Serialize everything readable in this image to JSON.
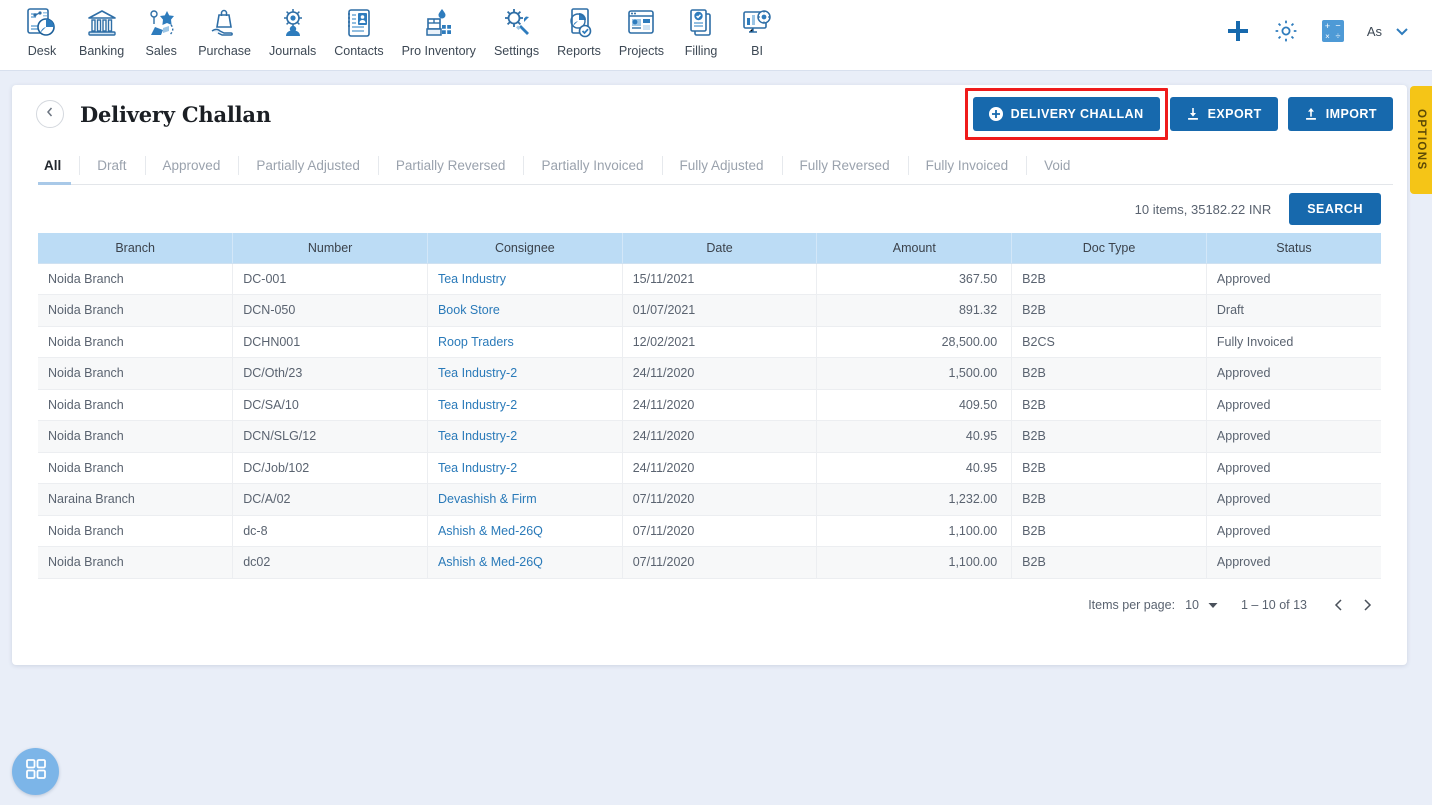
{
  "nav": {
    "items": [
      {
        "label": "Desk",
        "icon": "desk-icon"
      },
      {
        "label": "Banking",
        "icon": "bank-icon"
      },
      {
        "label": "Sales",
        "icon": "sales-icon"
      },
      {
        "label": "Purchase",
        "icon": "purchase-icon"
      },
      {
        "label": "Journals",
        "icon": "journals-icon"
      },
      {
        "label": "Contacts",
        "icon": "contacts-icon"
      },
      {
        "label": "Pro Inventory",
        "icon": "inventory-icon"
      },
      {
        "label": "Settings",
        "icon": "settings-icon"
      },
      {
        "label": "Reports",
        "icon": "reports-icon"
      },
      {
        "label": "Projects",
        "icon": "projects-icon"
      },
      {
        "label": "Filling",
        "icon": "filling-icon"
      },
      {
        "label": "BI",
        "icon": "bi-icon"
      }
    ],
    "right": {
      "add_icon": "plus-icon",
      "settings_icon": "gear-icon",
      "calculator_icon": "calculator-icon",
      "user_name": "As",
      "chevron_icon": "chevron-down-icon"
    }
  },
  "header": {
    "back_icon": "chevron-left-icon",
    "title": "Delivery Challan",
    "buttons": {
      "create": {
        "label": "DELIVERY CHALLAN",
        "icon": "plus-circle-icon",
        "highlighted": true
      },
      "export": {
        "label": "EXPORT",
        "icon": "download-icon"
      },
      "import": {
        "label": "IMPORT",
        "icon": "upload-icon"
      }
    }
  },
  "tabs": [
    {
      "label": "All",
      "active": true
    },
    {
      "label": "Draft",
      "active": false
    },
    {
      "label": "Approved",
      "active": false
    },
    {
      "label": "Partially Adjusted",
      "active": false
    },
    {
      "label": "Partially Reversed",
      "active": false
    },
    {
      "label": "Partially Invoiced",
      "active": false
    },
    {
      "label": "Fully Adjusted",
      "active": false
    },
    {
      "label": "Fully Reversed",
      "active": false
    },
    {
      "label": "Fully Invoiced",
      "active": false
    },
    {
      "label": "Void",
      "active": false
    }
  ],
  "search_row": {
    "items_summary": "10 items, 35182.22 INR",
    "search_label": "SEARCH"
  },
  "table": {
    "columns": [
      "Branch",
      "Number",
      "Consignee",
      "Date",
      "Amount",
      "Doc Type",
      "Status"
    ],
    "rows": [
      {
        "branch": "Noida Branch",
        "number": "DC-001",
        "consignee": "Tea Industry",
        "date": "15/11/2021",
        "amount": "367.50",
        "doc_type": "B2B",
        "status": "Approved"
      },
      {
        "branch": "Noida Branch",
        "number": "DCN-050",
        "consignee": "Book Store",
        "date": "01/07/2021",
        "amount": "891.32",
        "doc_type": "B2B",
        "status": "Draft"
      },
      {
        "branch": "Noida Branch",
        "number": "DCHN001",
        "consignee": "Roop Traders",
        "date": "12/02/2021",
        "amount": "28,500.00",
        "doc_type": "B2CS",
        "status": "Fully Invoiced"
      },
      {
        "branch": "Noida Branch",
        "number": "DC/Oth/23",
        "consignee": "Tea Industry-2",
        "date": "24/11/2020",
        "amount": "1,500.00",
        "doc_type": "B2B",
        "status": "Approved"
      },
      {
        "branch": "Noida Branch",
        "number": "DC/SA/10",
        "consignee": "Tea Industry-2",
        "date": "24/11/2020",
        "amount": "409.50",
        "doc_type": "B2B",
        "status": "Approved"
      },
      {
        "branch": "Noida Branch",
        "number": "DCN/SLG/12",
        "consignee": "Tea Industry-2",
        "date": "24/11/2020",
        "amount": "40.95",
        "doc_type": "B2B",
        "status": "Approved"
      },
      {
        "branch": "Noida Branch",
        "number": "DC/Job/102",
        "consignee": "Tea Industry-2",
        "date": "24/11/2020",
        "amount": "40.95",
        "doc_type": "B2B",
        "status": "Approved"
      },
      {
        "branch": "Naraina Branch",
        "number": "DC/A/02",
        "consignee": "Devashish & Firm",
        "date": "07/11/2020",
        "amount": "1,232.00",
        "doc_type": "B2B",
        "status": "Approved"
      },
      {
        "branch": "Noida Branch",
        "number": "dc-8",
        "consignee": "Ashish & Med-26Q",
        "date": "07/11/2020",
        "amount": "1,100.00",
        "doc_type": "B2B",
        "status": "Approved"
      },
      {
        "branch": "Noida Branch",
        "number": "dc02",
        "consignee": "Ashish & Med-26Q",
        "date": "07/11/2020",
        "amount": "1,100.00",
        "doc_type": "B2B",
        "status": "Approved"
      }
    ]
  },
  "paginator": {
    "items_per_page_label": "Items per page:",
    "items_per_page_value": "10",
    "range": "1 – 10 of 13",
    "prev_icon": "chevron-left-icon",
    "next_icon": "chevron-right-icon"
  },
  "options_tab": {
    "label": "OPTIONS"
  },
  "fab": {
    "icon": "grid-apps-icon"
  },
  "colors": {
    "accent_blue": "#1769ad",
    "link_blue": "#2a7ab9",
    "table_header": "#bcdcf5",
    "highlight_red": "#ef1b1b",
    "options_yellow": "#f5c517",
    "page_background": "#e9eef8"
  }
}
